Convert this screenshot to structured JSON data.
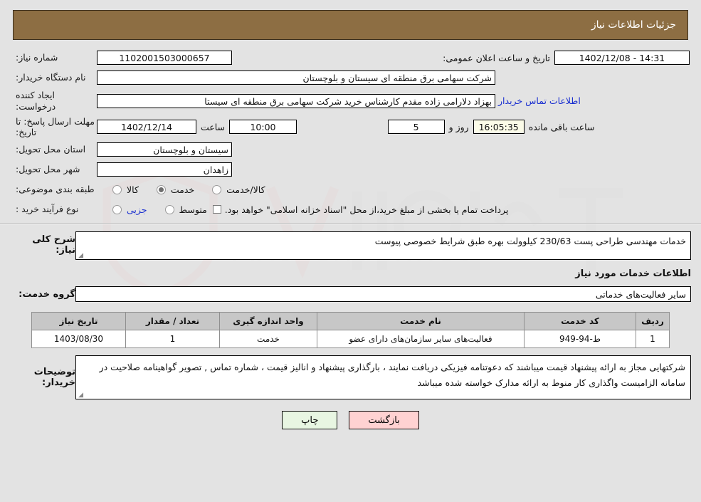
{
  "header": {
    "title": "جزئیات اطلاعات نیاز"
  },
  "form": {
    "need_number_label": "شماره نیاز:",
    "need_number_value": "1102001503000657",
    "announce_label": "تاریخ و ساعت اعلان عمومی:",
    "announce_value": "14:31 - 1402/12/08",
    "buyer_org_label": "نام دستگاه خریدار:",
    "buyer_org_value": "شرکت سهامی برق منطقه ای سیستان و بلوچستان",
    "requester_label": "ایجاد کننده درخواست:",
    "requester_value": "بهزاد  دلارامی زاده مقدم کارشناس خرید شرکت سهامی برق منطقه ای سیستا",
    "contact_link": "اطلاعات تماس خریدار",
    "deadline_label": "مهلت ارسال پاسخ: تا تاریخ:",
    "deadline_date": "1402/12/14",
    "deadline_hour_label": "ساعت",
    "deadline_time": "10:00",
    "remaining_days": "5",
    "remaining_days_label": "روز و",
    "remaining_clock": "16:05:35",
    "remaining_clock_label": "ساعت باقی مانده",
    "province_label": "استان محل تحویل:",
    "province_value": "سیستان و بلوچستان",
    "city_label": "شهر محل تحویل:",
    "city_value": "زاهدان",
    "category_label": "طبقه بندی موضوعی:",
    "category_options": [
      {
        "label": "کالا",
        "selected": false
      },
      {
        "label": "خدمت",
        "selected": true
      },
      {
        "label": "کالا/خدمت",
        "selected": false
      }
    ],
    "process_label": "نوع فرآیند خرید :",
    "process_options": [
      {
        "label": "جزیی",
        "selected": false
      },
      {
        "label": "متوسط",
        "selected": false
      }
    ],
    "treasury_checked": false,
    "treasury_note": "پرداخت تمام یا بخشی از مبلغ خرید،از محل \"اسناد خزانه اسلامی\" خواهد بود."
  },
  "description": {
    "label": "شرح کلی نیاز:",
    "value": "خدمات مهندسی طراحی پست 230/63 کیلوولت بهره طبق شرایط خصوصی پیوست"
  },
  "services_section": {
    "title": "اطلاعات خدمات مورد نیاز",
    "group_label": "گروه خدمت:",
    "group_value": "سایر فعالیت‌های خدماتی"
  },
  "table": {
    "columns": [
      "ردیف",
      "کد خدمت",
      "نام خدمت",
      "واحد اندازه گیری",
      "تعداد / مقدار",
      "تاریخ نیاز"
    ],
    "rows": [
      {
        "index": "1",
        "code": "ط-94-949",
        "name": "فعالیت‌های سایر سازمان‌های دارای عضو",
        "unit": "خدمت",
        "quantity": "1",
        "need_date": "1403/08/30"
      }
    ]
  },
  "buyer_notes": {
    "label": "توضیحات خریدار:",
    "value": "شرکتهایی مجاز به ارائه پیشنهاد قیمت میباشند که دعوتنامه فیزیکی دریافت نمایند ، بارگذاری پیشنهاد و انالیز قیمت ، شماره تماس , تصویر گواهینامه صلاحیت در سامانه الزامیست واگذاری کار منوط به ارائه مدارک خواسته شده میباشد"
  },
  "footer": {
    "back_label": "بازگشت",
    "print_label": "چاپ"
  },
  "colors": {
    "header_bg": "#8d6e43",
    "table_header_bg": "#c7c7c7",
    "link": "#1a2fd0",
    "back_button": "#ffd2d2",
    "print_button": "#e8f6e2"
  }
}
